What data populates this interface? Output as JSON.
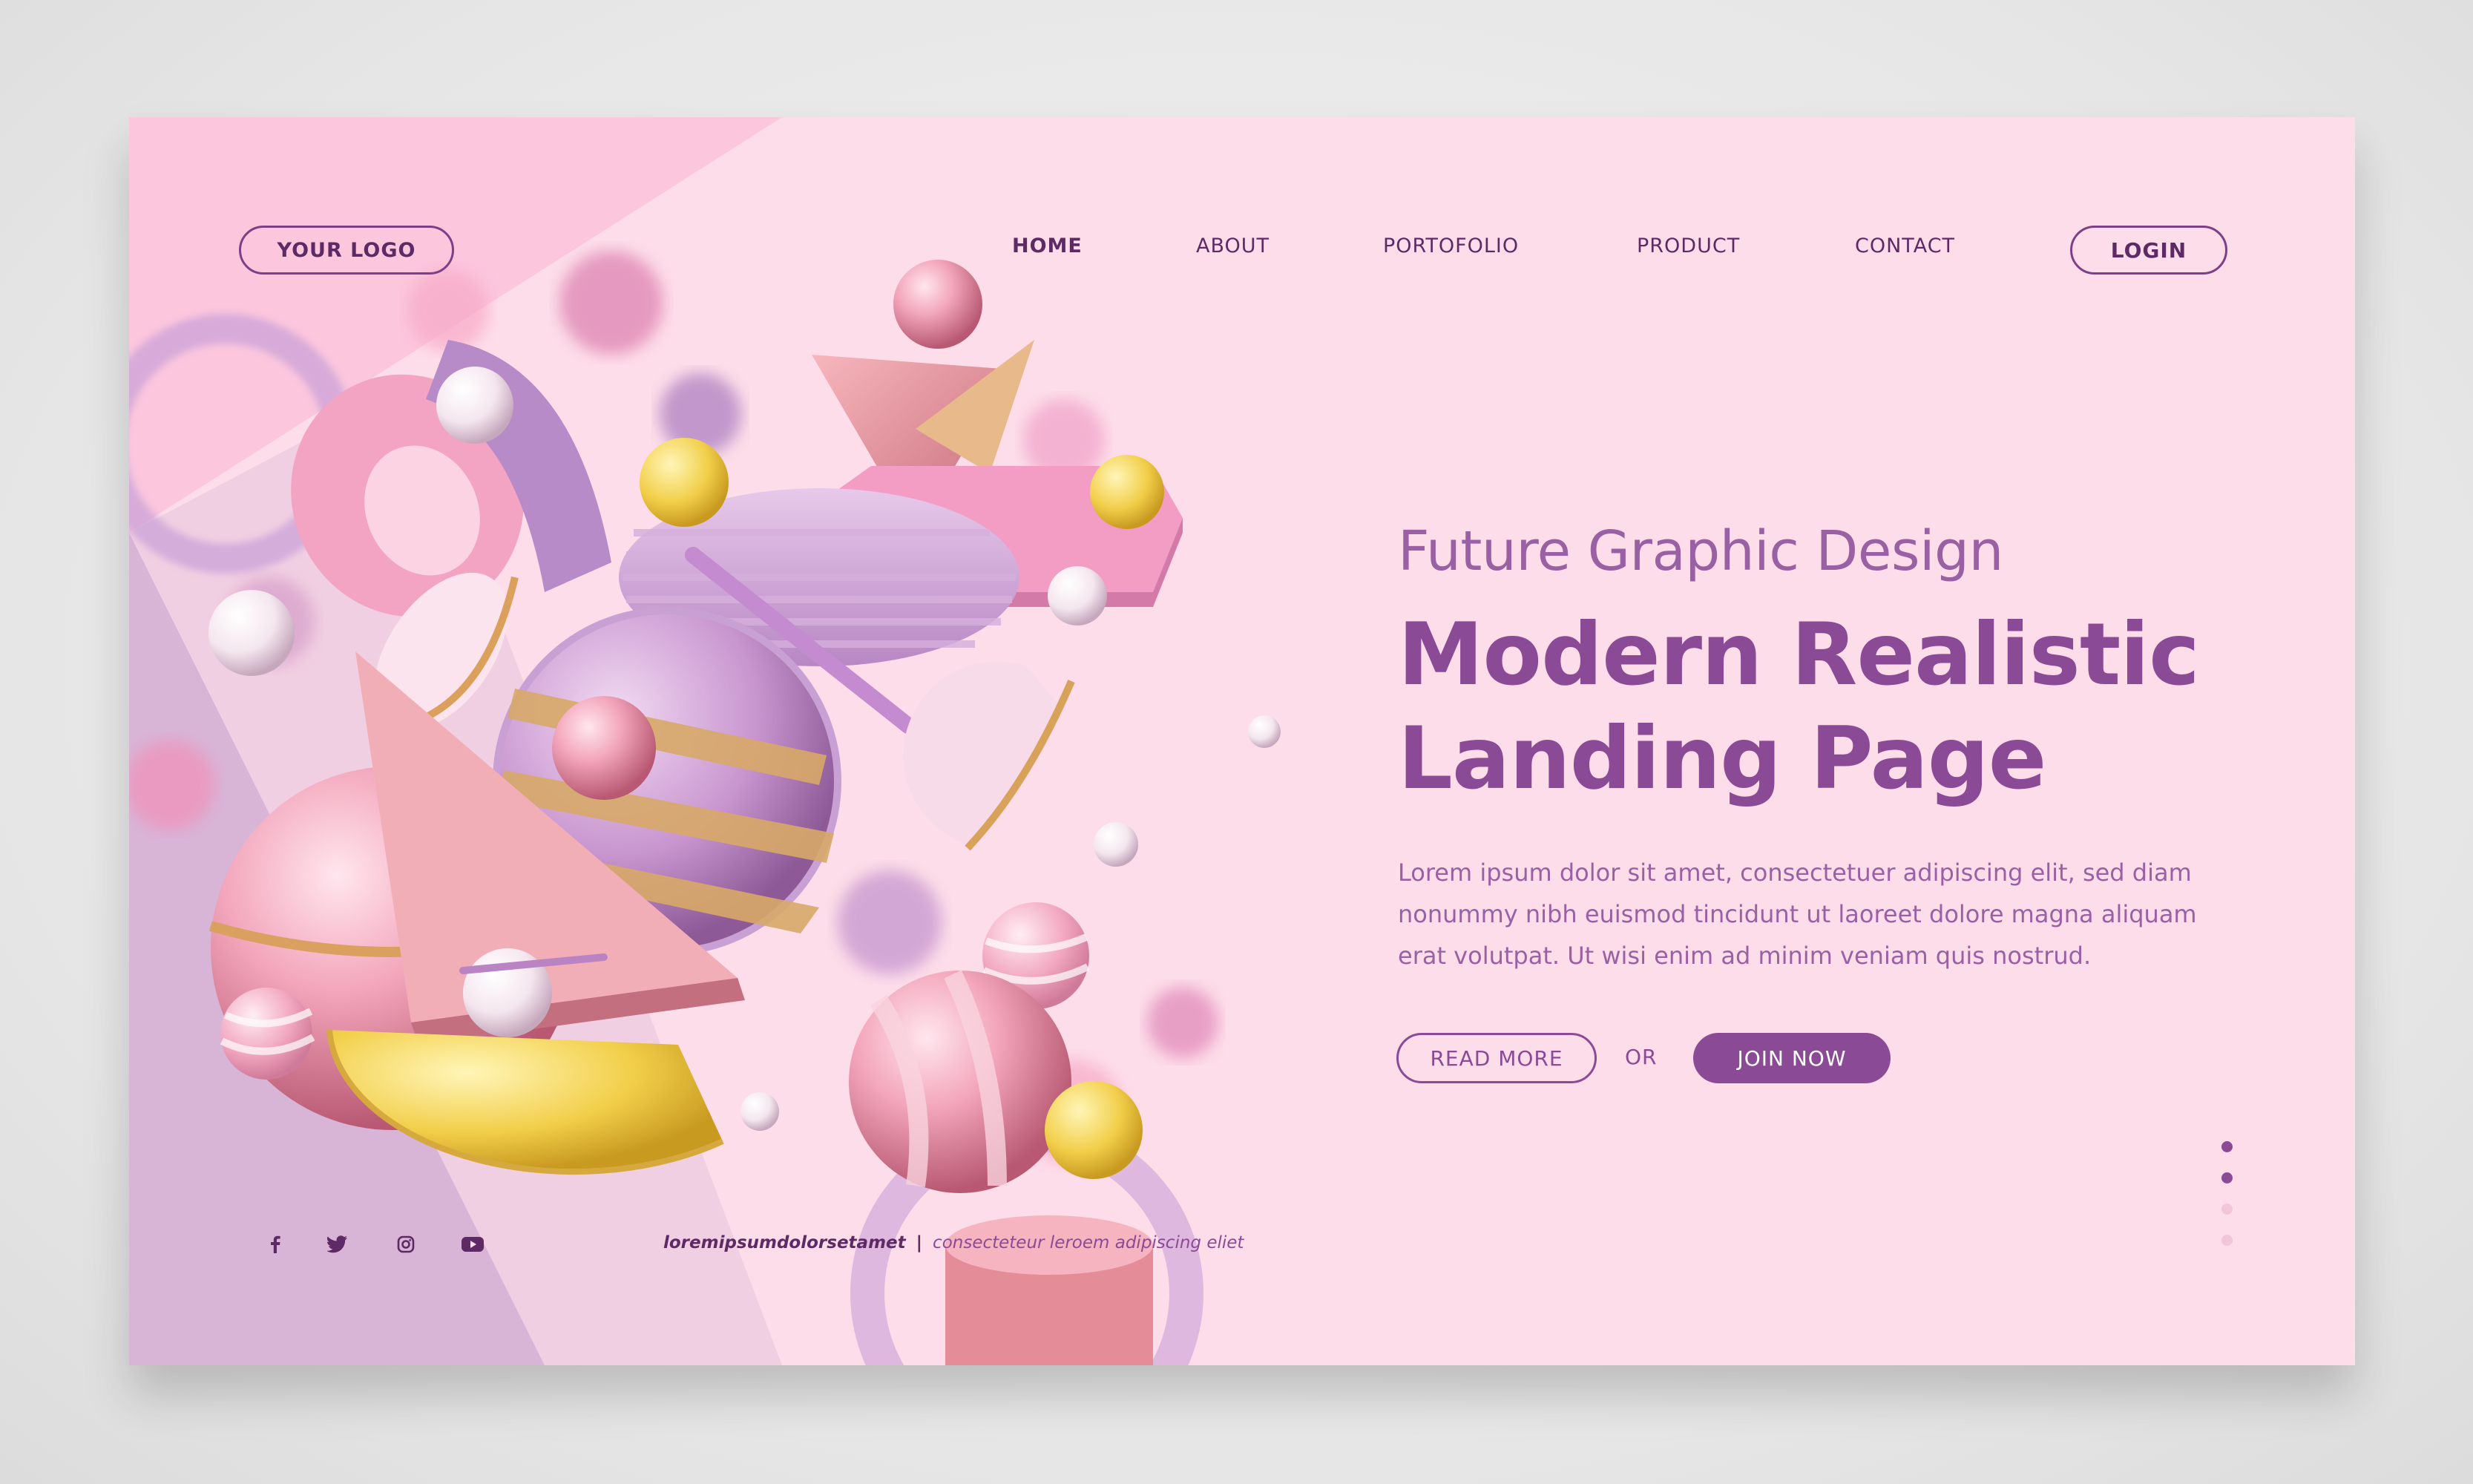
{
  "header": {
    "logo_label": "YOUR LOGO",
    "nav": [
      {
        "label": "HOME",
        "active": true
      },
      {
        "label": "ABOUT",
        "active": false
      },
      {
        "label": "PORTOFOLIO",
        "active": false
      },
      {
        "label": "PRODUCT",
        "active": false
      },
      {
        "label": "CONTACT",
        "active": false
      }
    ],
    "login_label": "LOGIN"
  },
  "hero": {
    "subtitle": "Future Graphic Design",
    "title_line1": "Modern Realistic",
    "title_line2": "Landing Page",
    "description": "Lorem ipsum dolor sit amet, consectetuer adipiscing elit, sed diam nonummy nibh euismod tincidunt ut laoreet dolore magna aliquam erat volutpat. Ut wisi enim ad minim veniam quis nostrud.",
    "read_more_label": "READ MORE",
    "or_label": "OR",
    "join_now_label": "JOIN NOW"
  },
  "pagination": {
    "total": 4,
    "active_indexes": [
      0,
      1
    ]
  },
  "footer": {
    "social_icons": [
      "facebook-icon",
      "twitter-icon",
      "instagram-icon",
      "youtube-icon"
    ],
    "handle": "loremipsumdolorsetamet",
    "separator": "|",
    "tagline": "consecteteur leroem adipiscing eliet"
  },
  "colors": {
    "page_bg": "#fddde9",
    "accent": "#8b4a95",
    "dark_text": "#5e2a66",
    "outer_bg": "#e6e6e6"
  }
}
